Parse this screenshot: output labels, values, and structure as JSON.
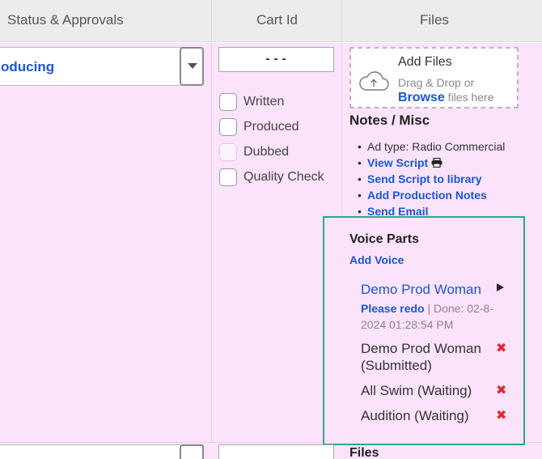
{
  "columns": {
    "status": "Status & Approvals",
    "cart_id": "Cart Id",
    "files": "Files"
  },
  "row": {
    "status_value": "oducing",
    "cart_id": "---",
    "checklist": [
      {
        "label": "Written",
        "checked": false,
        "enabled": true
      },
      {
        "label": "Produced",
        "checked": false,
        "enabled": true
      },
      {
        "label": "Dubbed",
        "checked": false,
        "enabled": false
      },
      {
        "label": "Quality Check",
        "checked": false,
        "enabled": true
      }
    ],
    "upload": {
      "title": "Add Files",
      "subtitle": "Drag & Drop or",
      "browse": "Browse",
      "browse_suffix": " files here",
      "icon": "cloud-upload-icon"
    },
    "notes": {
      "title": "Notes / Misc",
      "ad_type": "Ad type: Radio Commercial",
      "links": [
        "View Script",
        "Send Script to library",
        "Add Production Notes",
        "Send Email"
      ],
      "print_icon": "printer-icon"
    },
    "voice_parts": {
      "title": "Voice Parts",
      "add_label": "Add Voice",
      "active": {
        "name": "Demo Prod Woman",
        "action": "Please redo",
        "done_text": " | Done: 02-8-2024 01:28:54 PM"
      },
      "items": [
        {
          "label": "Demo Prod Woman (Submitted)"
        },
        {
          "label": "All Swim (Waiting)"
        },
        {
          "label": "Audition (Waiting)"
        }
      ],
      "accent": "#2aa98c",
      "remove_color": "#e5262a"
    }
  },
  "row2": {
    "files_title": "Files"
  },
  "colors": {
    "row_bg": "#fbe3fb",
    "link": "#1a56d6",
    "header_bg": "#ececec"
  }
}
